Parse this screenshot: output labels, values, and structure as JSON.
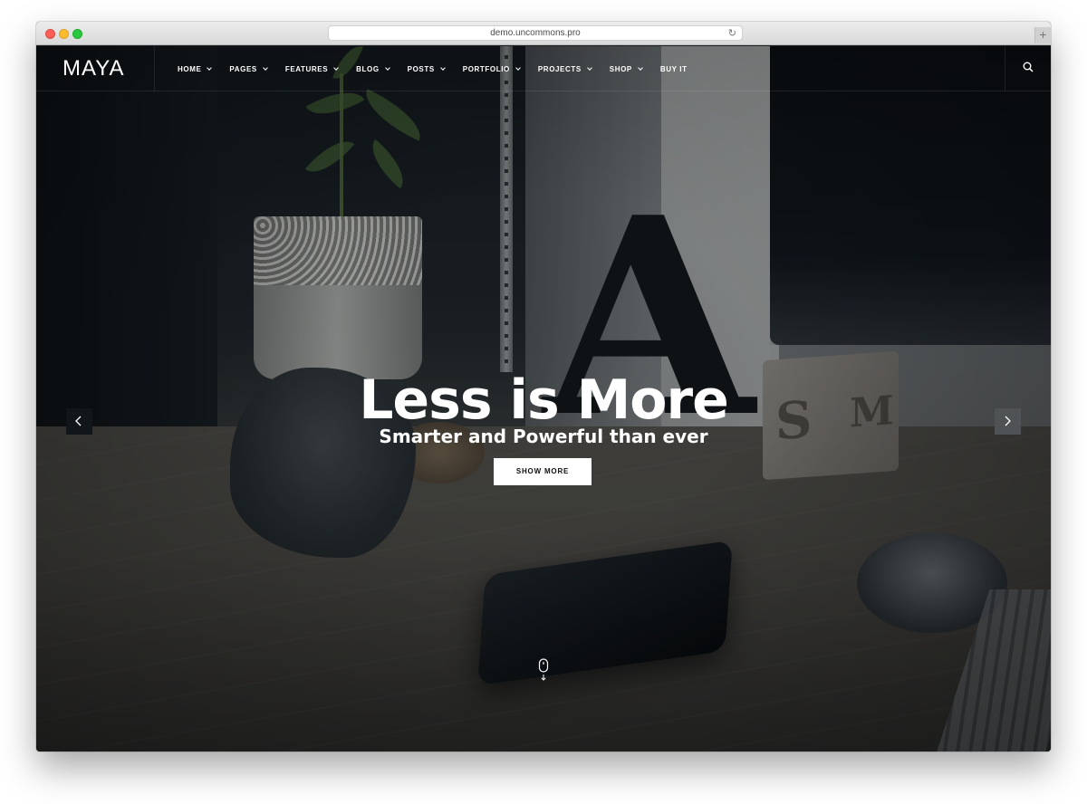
{
  "browser": {
    "url": "demo.uncommons.pro"
  },
  "site": {
    "logo": "MAYA",
    "nav": [
      {
        "label": "HOME",
        "dropdown": true
      },
      {
        "label": "PAGES",
        "dropdown": true
      },
      {
        "label": "FEATURES",
        "dropdown": true
      },
      {
        "label": "BLOG",
        "dropdown": true
      },
      {
        "label": "POSTS",
        "dropdown": true
      },
      {
        "label": "PORTFOLIO",
        "dropdown": true
      },
      {
        "label": "PROJECTS",
        "dropdown": true
      },
      {
        "label": "SHOP",
        "dropdown": true
      },
      {
        "label": "BUY IT",
        "dropdown": false
      }
    ],
    "search_icon": "search-icon"
  },
  "hero": {
    "title": "Less is More",
    "subtitle": "Smarter and Powerful than ever",
    "button_label": "SHOW MORE",
    "prev_icon": "chevron-left-icon",
    "next_icon": "chevron-right-icon",
    "scroll_icon": "mouse-scroll-icon"
  },
  "colors": {
    "text": "#ffffff",
    "button_bg": "#ffffff",
    "button_text": "#111111"
  }
}
